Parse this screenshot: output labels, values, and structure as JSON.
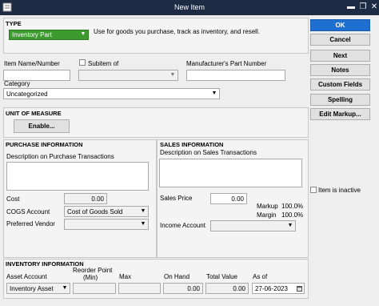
{
  "window": {
    "title": "New Item"
  },
  "type": {
    "section_label": "TYPE",
    "selected": "Inventory Part",
    "description": "Use for goods you purchase, track as inventory, and resell."
  },
  "item": {
    "name_label": "Item Name/Number",
    "subitem_label": "Subitem of",
    "mpn_label": "Manufacturer's Part Number",
    "category_label": "Category",
    "category_value": "Uncategorized"
  },
  "uom": {
    "section_label": "UNIT OF MEASURE",
    "enable_label": "Enable..."
  },
  "purchase": {
    "section_label": "PURCHASE INFORMATION",
    "desc_label": "Description on Purchase Transactions",
    "cost_label": "Cost",
    "cost_value": "0.00",
    "cogs_label": "COGS Account",
    "cogs_value": "Cost of Goods Sold",
    "vendor_label": "Preferred Vendor"
  },
  "sales": {
    "section_label": "SALES INFORMATION",
    "desc_label": "Description on Sales Transactions",
    "price_label": "Sales Price",
    "price_value": "0.00",
    "markup_label": "Markup",
    "markup_value": "100.0%",
    "margin_label": "Margin",
    "margin_value": "100.0%",
    "income_label": "Income Account"
  },
  "inventory": {
    "section_label": "INVENTORY INFORMATION",
    "asset_label": "Asset Account",
    "asset_value": "Inventory Asset",
    "reorder_label_1": "Reorder Point",
    "reorder_label_2": "(Min)",
    "max_label": "Max",
    "onhand_label": "On Hand",
    "onhand_value": "0.00",
    "totalvalue_label": "Total Value",
    "totalvalue_value": "0.00",
    "asof_label": "As of",
    "asof_value": "27-06-2023"
  },
  "side_buttons": {
    "ok": "OK",
    "cancel": "Cancel",
    "next": "Next",
    "notes": "Notes",
    "custom_fields": "Custom Fields",
    "spelling": "Spelling",
    "edit_markup": "Edit Markup..."
  },
  "inactive_label": "Item is inactive",
  "colors": {
    "titlebar": "#1d2b44",
    "ok_button": "#1f6fd0",
    "type_dropdown": "#3c9a2e"
  }
}
